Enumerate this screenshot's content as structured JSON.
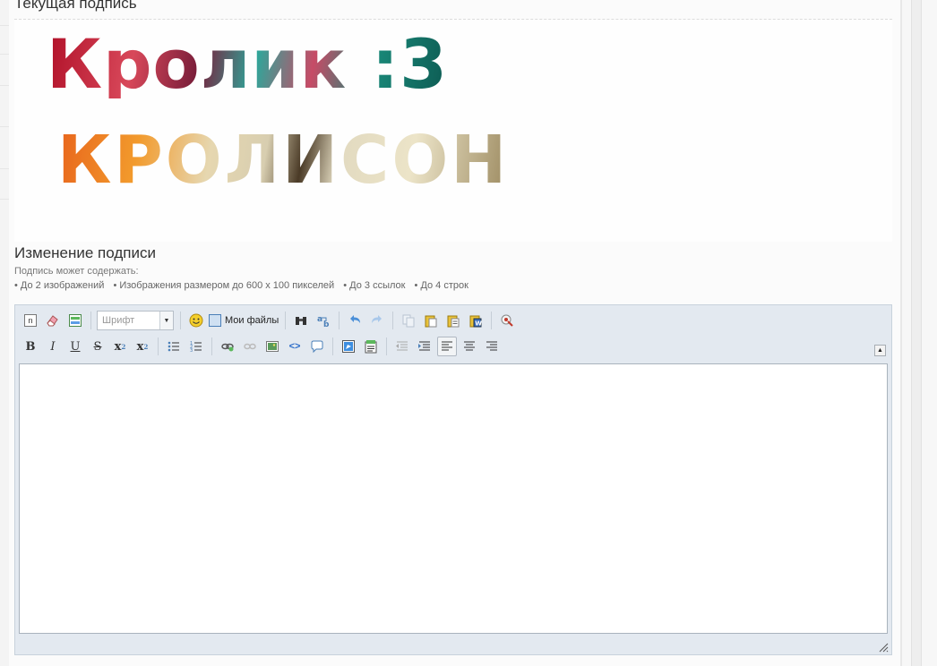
{
  "current_signature": {
    "title": "Текущая подпись",
    "line1": "Кролик :3",
    "line2": "КРОЛИСОН"
  },
  "edit_signature": {
    "title": "Изменение подписи",
    "hint": "Подпись может содержать:",
    "rules": [
      "• До 2 изображений",
      "• Изображения размером до 600 х 100 пикселей",
      "• До 3 ссылок",
      "• До 4 строк"
    ]
  },
  "editor": {
    "font_select": "Шрифт",
    "my_files": "Мои файлы",
    "format": {
      "bold": "B",
      "italic": "I",
      "underline": "U",
      "strike": "S",
      "subscript": "x",
      "superscript": "x"
    },
    "body_value": ""
  },
  "colors": {
    "toolbar_bg": "#e3e9f0",
    "icon_blue": "#4a7fb8",
    "icon_yellow": "#e9c23a",
    "smile_yellow": "#f4cf2b"
  }
}
